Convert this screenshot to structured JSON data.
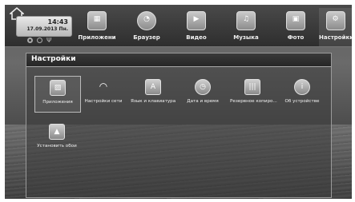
{
  "status": {
    "time": "14:43",
    "date": "17.09.2013 Пн."
  },
  "tabs": [
    {
      "label": "Приложени",
      "icon": "apps-icon"
    },
    {
      "label": "Браузер",
      "icon": "browser-icon"
    },
    {
      "label": "Видео",
      "icon": "video-icon"
    },
    {
      "label": "Музыка",
      "icon": "music-icon"
    },
    {
      "label": "Фото",
      "icon": "photo-icon"
    },
    {
      "label": "Настройки",
      "icon": "settings-icon",
      "active": true
    }
  ],
  "panel": {
    "title": "Настройки",
    "items": [
      {
        "label": "Приложения",
        "icon": "apps-icon",
        "selected": true
      },
      {
        "label": "Настройки сети",
        "icon": "wifi-icon"
      },
      {
        "label": "Язык и клавиатура",
        "icon": "language-icon"
      },
      {
        "label": "Дата и время",
        "icon": "clock-icon"
      },
      {
        "label": "Резервное копиро...",
        "icon": "backup-icon"
      },
      {
        "label": "Об устройстве",
        "icon": "info-icon"
      },
      {
        "label": "Установить обои",
        "icon": "wallpaper-icon"
      }
    ]
  }
}
